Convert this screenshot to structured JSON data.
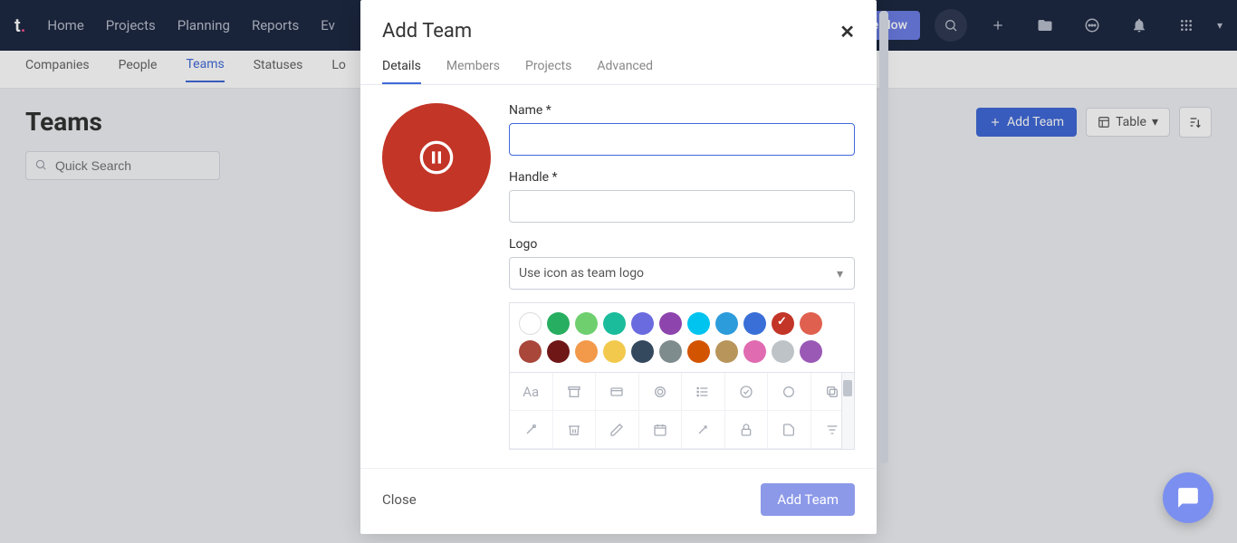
{
  "topnav": {
    "items": [
      "Home",
      "Projects",
      "Planning",
      "Reports",
      "Ev"
    ],
    "upgrade": "de Now"
  },
  "subnav": {
    "items": [
      "Companies",
      "People",
      "Teams",
      "Statuses",
      "Lo"
    ]
  },
  "page": {
    "title": "Teams",
    "search_placeholder": "Quick Search",
    "add_team": "Add Team",
    "view_label": "Table"
  },
  "modal": {
    "title": "Add Team",
    "tabs": [
      "Details",
      "Members",
      "Projects",
      "Advanced"
    ],
    "labels": {
      "name": "Name *",
      "handle": "Handle *",
      "logo": "Logo"
    },
    "logo_select": "Use icon as team logo",
    "colors": [
      {
        "hex": "#ffffff",
        "white": true
      },
      {
        "hex": "#27ae60"
      },
      {
        "hex": "#6fcf6f"
      },
      {
        "hex": "#1abc9c"
      },
      {
        "hex": "#6b6be0"
      },
      {
        "hex": "#8e44ad"
      },
      {
        "hex": "#00c4f0"
      },
      {
        "hex": "#2d9cdb"
      },
      {
        "hex": "#3a6fd8"
      },
      {
        "hex": "#c33527",
        "selected": true
      },
      {
        "hex": "#e0604f"
      },
      {
        "hex": "#a8473a"
      },
      {
        "hex": "#6f1717"
      },
      {
        "hex": "#f2994a"
      },
      {
        "hex": "#f2c94c"
      },
      {
        "hex": "#34495e"
      },
      {
        "hex": "#7f8c8d"
      },
      {
        "hex": "#d35400"
      },
      {
        "hex": "#b8955a"
      },
      {
        "hex": "#e06bb0"
      },
      {
        "hex": "#bdc3c7"
      },
      {
        "hex": "#9b59b6"
      }
    ],
    "footer": {
      "close": "Close",
      "submit": "Add Team"
    }
  }
}
